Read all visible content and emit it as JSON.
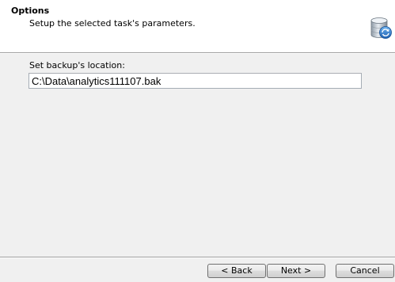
{
  "header": {
    "title": "Options",
    "subtitle": "Setup the selected task's parameters.",
    "icon": "database-backup-icon"
  },
  "backup_location": {
    "label": "Set backup's location:",
    "value": "C:\\Data\\analytics111107.bak"
  },
  "buttons": {
    "back": "< Back",
    "next": "Next >",
    "cancel": "Cancel"
  },
  "colors": {
    "header_background": "#ffffff",
    "body_background": "#f0f0f0",
    "icon_accent": "#2f7fd0"
  }
}
